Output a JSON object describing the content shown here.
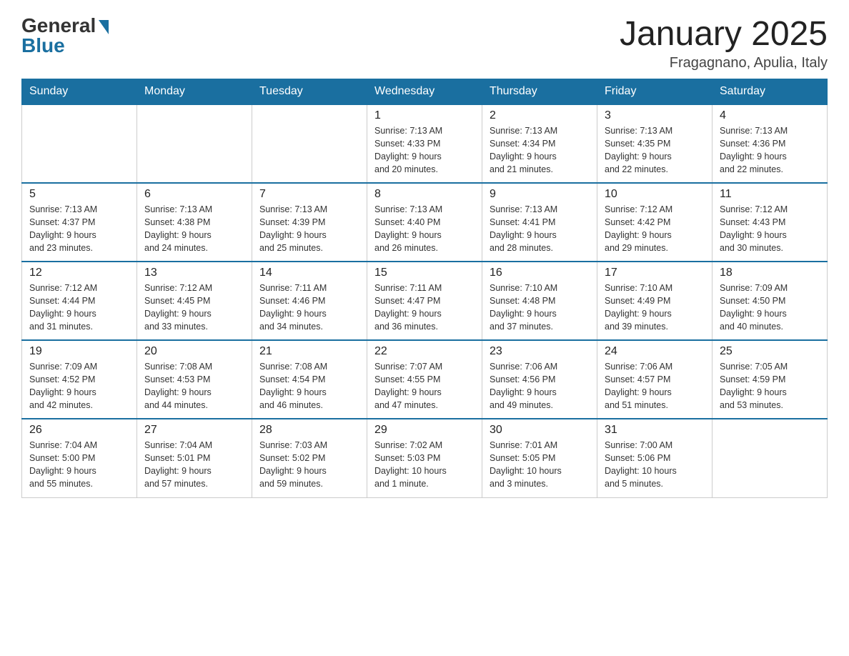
{
  "header": {
    "logo_general": "General",
    "logo_blue": "Blue",
    "title": "January 2025",
    "location": "Fragagnano, Apulia, Italy"
  },
  "weekdays": [
    "Sunday",
    "Monday",
    "Tuesday",
    "Wednesday",
    "Thursday",
    "Friday",
    "Saturday"
  ],
  "weeks": [
    [
      {
        "day": "",
        "info": ""
      },
      {
        "day": "",
        "info": ""
      },
      {
        "day": "",
        "info": ""
      },
      {
        "day": "1",
        "info": "Sunrise: 7:13 AM\nSunset: 4:33 PM\nDaylight: 9 hours\nand 20 minutes."
      },
      {
        "day": "2",
        "info": "Sunrise: 7:13 AM\nSunset: 4:34 PM\nDaylight: 9 hours\nand 21 minutes."
      },
      {
        "day": "3",
        "info": "Sunrise: 7:13 AM\nSunset: 4:35 PM\nDaylight: 9 hours\nand 22 minutes."
      },
      {
        "day": "4",
        "info": "Sunrise: 7:13 AM\nSunset: 4:36 PM\nDaylight: 9 hours\nand 22 minutes."
      }
    ],
    [
      {
        "day": "5",
        "info": "Sunrise: 7:13 AM\nSunset: 4:37 PM\nDaylight: 9 hours\nand 23 minutes."
      },
      {
        "day": "6",
        "info": "Sunrise: 7:13 AM\nSunset: 4:38 PM\nDaylight: 9 hours\nand 24 minutes."
      },
      {
        "day": "7",
        "info": "Sunrise: 7:13 AM\nSunset: 4:39 PM\nDaylight: 9 hours\nand 25 minutes."
      },
      {
        "day": "8",
        "info": "Sunrise: 7:13 AM\nSunset: 4:40 PM\nDaylight: 9 hours\nand 26 minutes."
      },
      {
        "day": "9",
        "info": "Sunrise: 7:13 AM\nSunset: 4:41 PM\nDaylight: 9 hours\nand 28 minutes."
      },
      {
        "day": "10",
        "info": "Sunrise: 7:12 AM\nSunset: 4:42 PM\nDaylight: 9 hours\nand 29 minutes."
      },
      {
        "day": "11",
        "info": "Sunrise: 7:12 AM\nSunset: 4:43 PM\nDaylight: 9 hours\nand 30 minutes."
      }
    ],
    [
      {
        "day": "12",
        "info": "Sunrise: 7:12 AM\nSunset: 4:44 PM\nDaylight: 9 hours\nand 31 minutes."
      },
      {
        "day": "13",
        "info": "Sunrise: 7:12 AM\nSunset: 4:45 PM\nDaylight: 9 hours\nand 33 minutes."
      },
      {
        "day": "14",
        "info": "Sunrise: 7:11 AM\nSunset: 4:46 PM\nDaylight: 9 hours\nand 34 minutes."
      },
      {
        "day": "15",
        "info": "Sunrise: 7:11 AM\nSunset: 4:47 PM\nDaylight: 9 hours\nand 36 minutes."
      },
      {
        "day": "16",
        "info": "Sunrise: 7:10 AM\nSunset: 4:48 PM\nDaylight: 9 hours\nand 37 minutes."
      },
      {
        "day": "17",
        "info": "Sunrise: 7:10 AM\nSunset: 4:49 PM\nDaylight: 9 hours\nand 39 minutes."
      },
      {
        "day": "18",
        "info": "Sunrise: 7:09 AM\nSunset: 4:50 PM\nDaylight: 9 hours\nand 40 minutes."
      }
    ],
    [
      {
        "day": "19",
        "info": "Sunrise: 7:09 AM\nSunset: 4:52 PM\nDaylight: 9 hours\nand 42 minutes."
      },
      {
        "day": "20",
        "info": "Sunrise: 7:08 AM\nSunset: 4:53 PM\nDaylight: 9 hours\nand 44 minutes."
      },
      {
        "day": "21",
        "info": "Sunrise: 7:08 AM\nSunset: 4:54 PM\nDaylight: 9 hours\nand 46 minutes."
      },
      {
        "day": "22",
        "info": "Sunrise: 7:07 AM\nSunset: 4:55 PM\nDaylight: 9 hours\nand 47 minutes."
      },
      {
        "day": "23",
        "info": "Sunrise: 7:06 AM\nSunset: 4:56 PM\nDaylight: 9 hours\nand 49 minutes."
      },
      {
        "day": "24",
        "info": "Sunrise: 7:06 AM\nSunset: 4:57 PM\nDaylight: 9 hours\nand 51 minutes."
      },
      {
        "day": "25",
        "info": "Sunrise: 7:05 AM\nSunset: 4:59 PM\nDaylight: 9 hours\nand 53 minutes."
      }
    ],
    [
      {
        "day": "26",
        "info": "Sunrise: 7:04 AM\nSunset: 5:00 PM\nDaylight: 9 hours\nand 55 minutes."
      },
      {
        "day": "27",
        "info": "Sunrise: 7:04 AM\nSunset: 5:01 PM\nDaylight: 9 hours\nand 57 minutes."
      },
      {
        "day": "28",
        "info": "Sunrise: 7:03 AM\nSunset: 5:02 PM\nDaylight: 9 hours\nand 59 minutes."
      },
      {
        "day": "29",
        "info": "Sunrise: 7:02 AM\nSunset: 5:03 PM\nDaylight: 10 hours\nand 1 minute."
      },
      {
        "day": "30",
        "info": "Sunrise: 7:01 AM\nSunset: 5:05 PM\nDaylight: 10 hours\nand 3 minutes."
      },
      {
        "day": "31",
        "info": "Sunrise: 7:00 AM\nSunset: 5:06 PM\nDaylight: 10 hours\nand 5 minutes."
      },
      {
        "day": "",
        "info": ""
      }
    ]
  ]
}
